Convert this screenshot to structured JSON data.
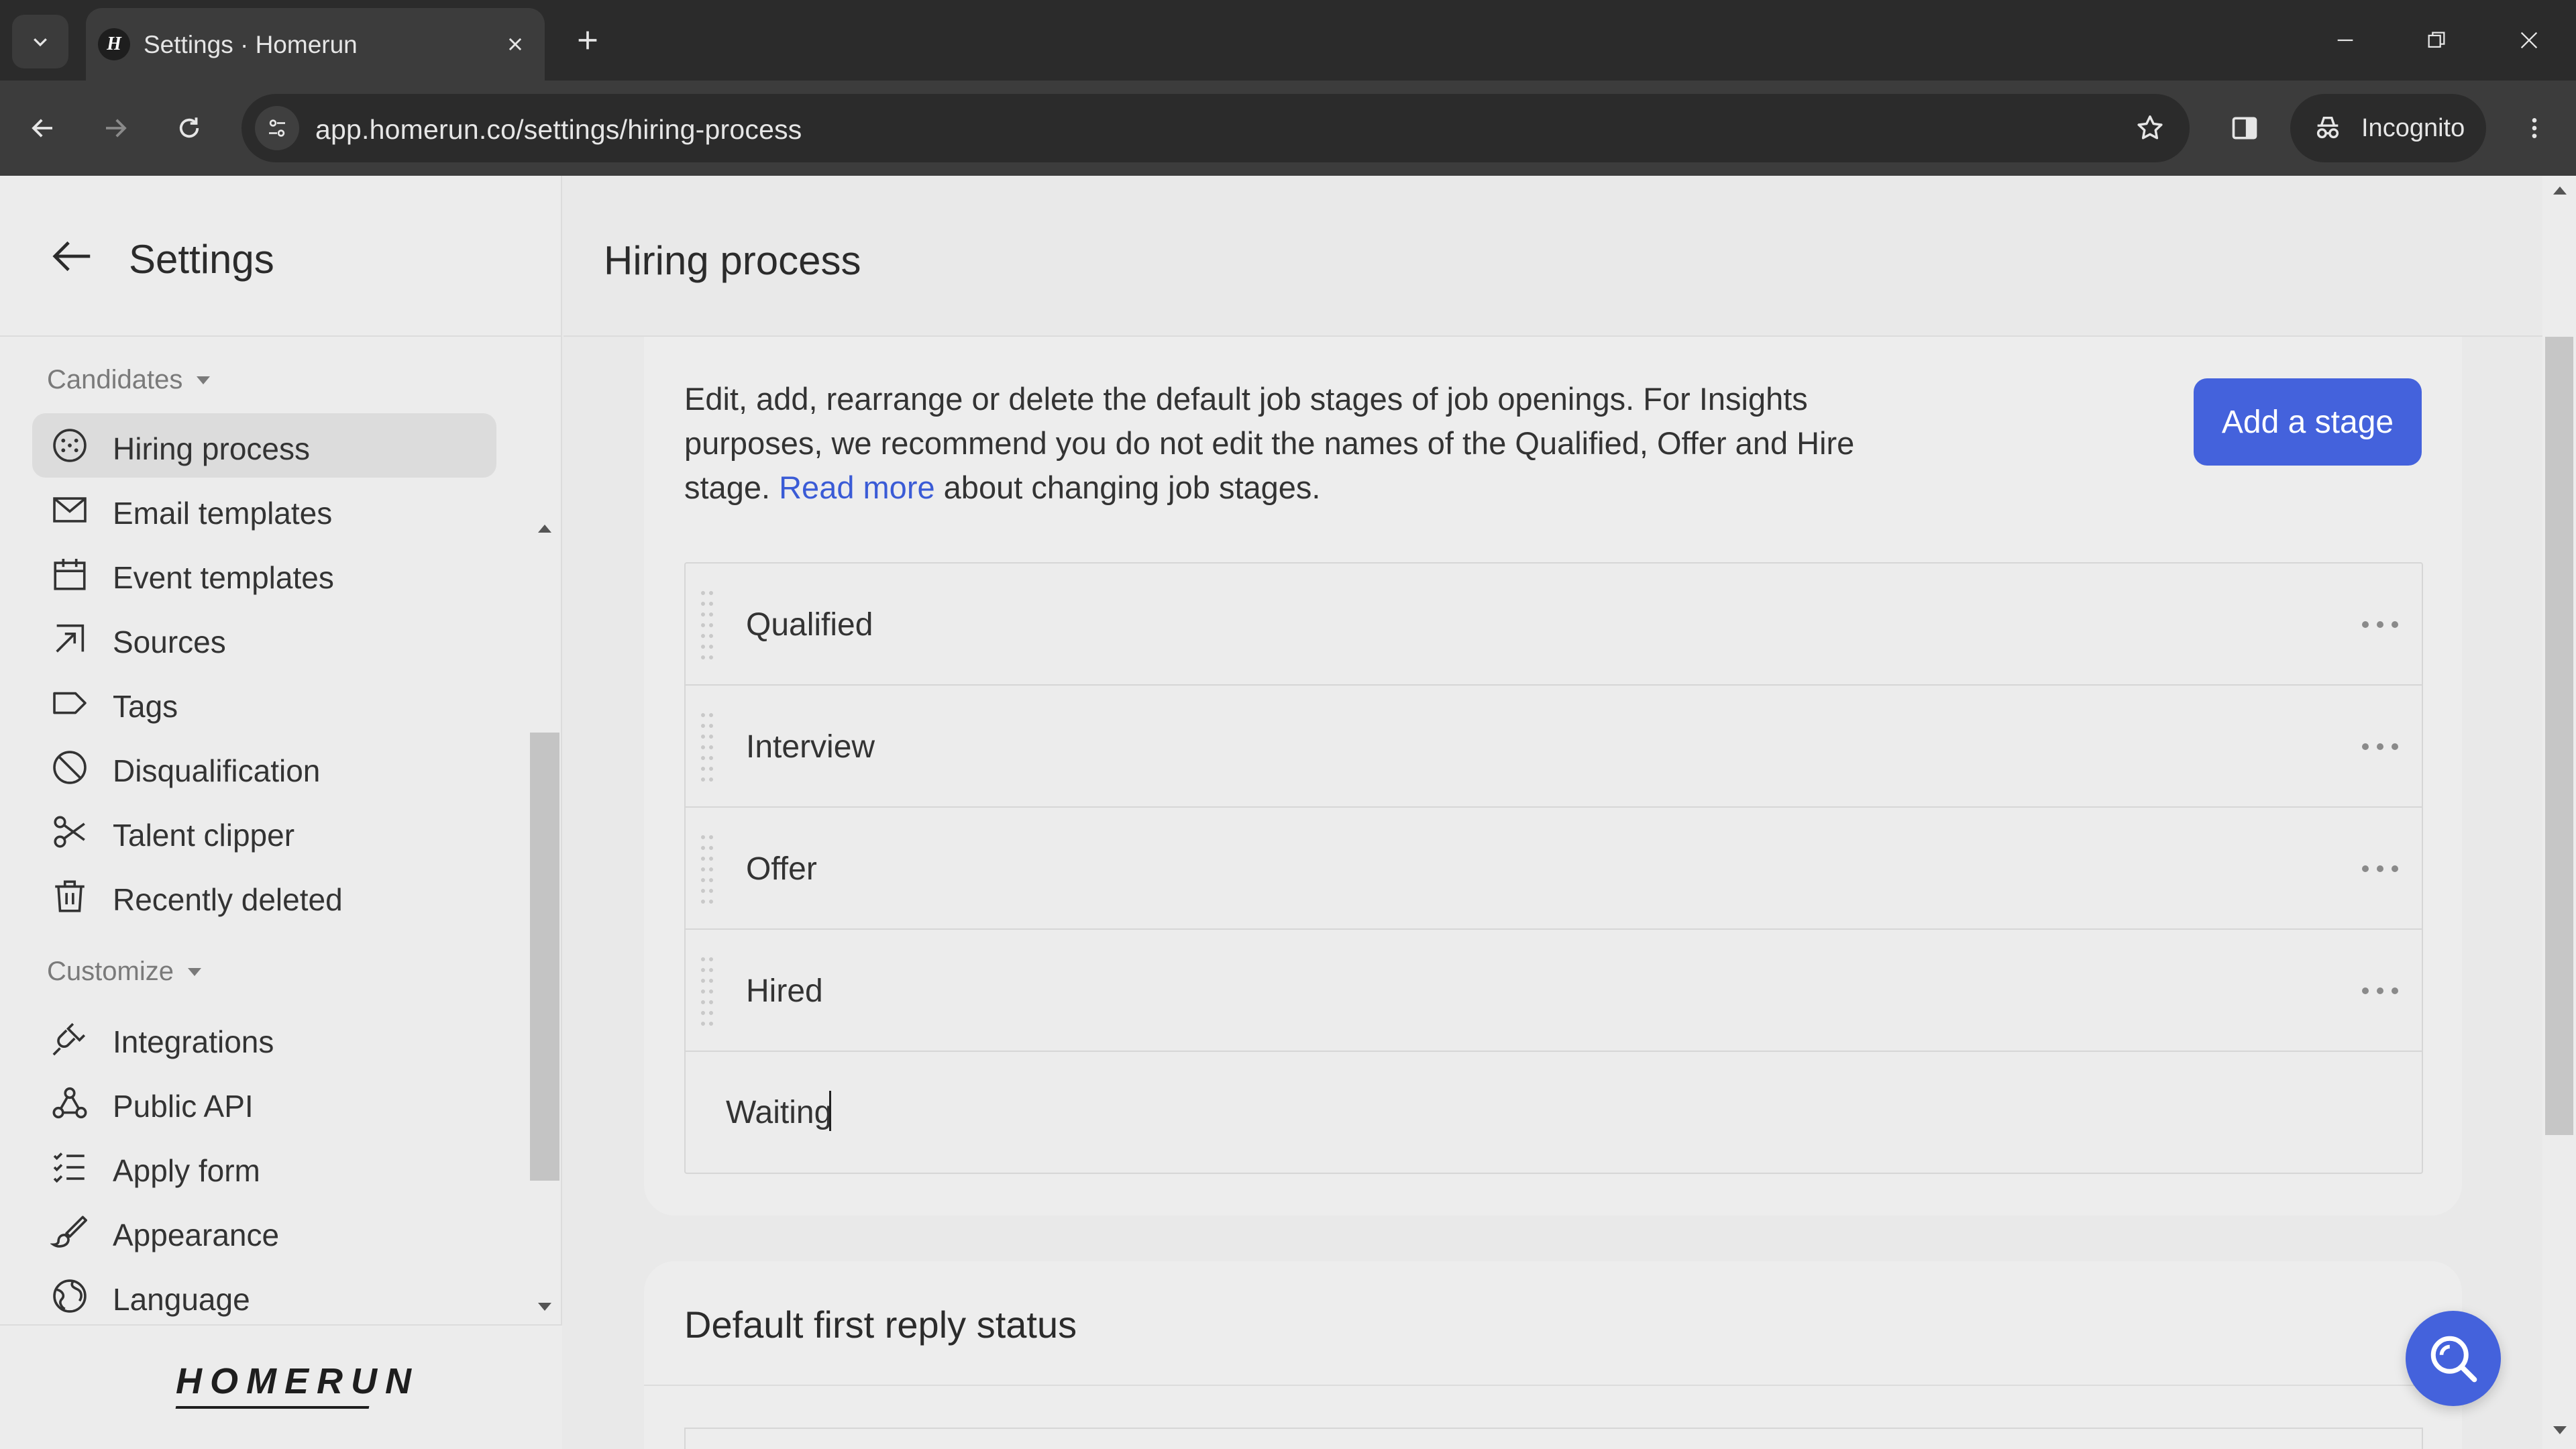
{
  "browser": {
    "tab_title": "Settings · Homerun",
    "tab_favicon_letter": "H",
    "url": "app.homerun.co/settings/hiring-process",
    "incognito_label": "Incognito"
  },
  "sidebar": {
    "title": "Settings",
    "sections": [
      {
        "label": "Candidates",
        "items": [
          {
            "label": "Hiring process",
            "icon": "hiring-process-icon",
            "active": true
          },
          {
            "label": "Email templates",
            "icon": "mail-icon"
          },
          {
            "label": "Event templates",
            "icon": "calendar-icon"
          },
          {
            "label": "Sources",
            "icon": "source-arrow-icon"
          },
          {
            "label": "Tags",
            "icon": "tag-icon"
          },
          {
            "label": "Disqualification",
            "icon": "ban-icon"
          },
          {
            "label": "Talent clipper",
            "icon": "scissors-icon"
          },
          {
            "label": "Recently deleted",
            "icon": "trash-icon"
          }
        ]
      },
      {
        "label": "Customize",
        "items": [
          {
            "label": "Integrations",
            "icon": "plug-icon"
          },
          {
            "label": "Public API",
            "icon": "api-nodes-icon"
          },
          {
            "label": "Apply form",
            "icon": "list-check-icon"
          },
          {
            "label": "Appearance",
            "icon": "brush-icon"
          },
          {
            "label": "Language",
            "icon": "globe-icon"
          }
        ]
      }
    ],
    "logo_text": "HOMERUN"
  },
  "main": {
    "title": "Hiring process",
    "description": {
      "before_link": "Edit, add, rearrange or delete the default job stages of job openings. For Insights purposes, we recommend you do not edit the names of the Qualified, Offer and Hire stage.",
      "link": "Read more",
      "after_link": "about changing job stages."
    },
    "add_stage_label": "Add a stage",
    "stages": [
      "Qualified",
      "Interview",
      "Offer",
      "Hired"
    ],
    "new_stage_value": "Waiting",
    "second_card_title": "Default first reply status"
  },
  "colors": {
    "accent": "#4462dc",
    "link": "#3a5bd6",
    "chrome_dark": "#2b2b2b",
    "active_item": "#dcdcdc"
  }
}
